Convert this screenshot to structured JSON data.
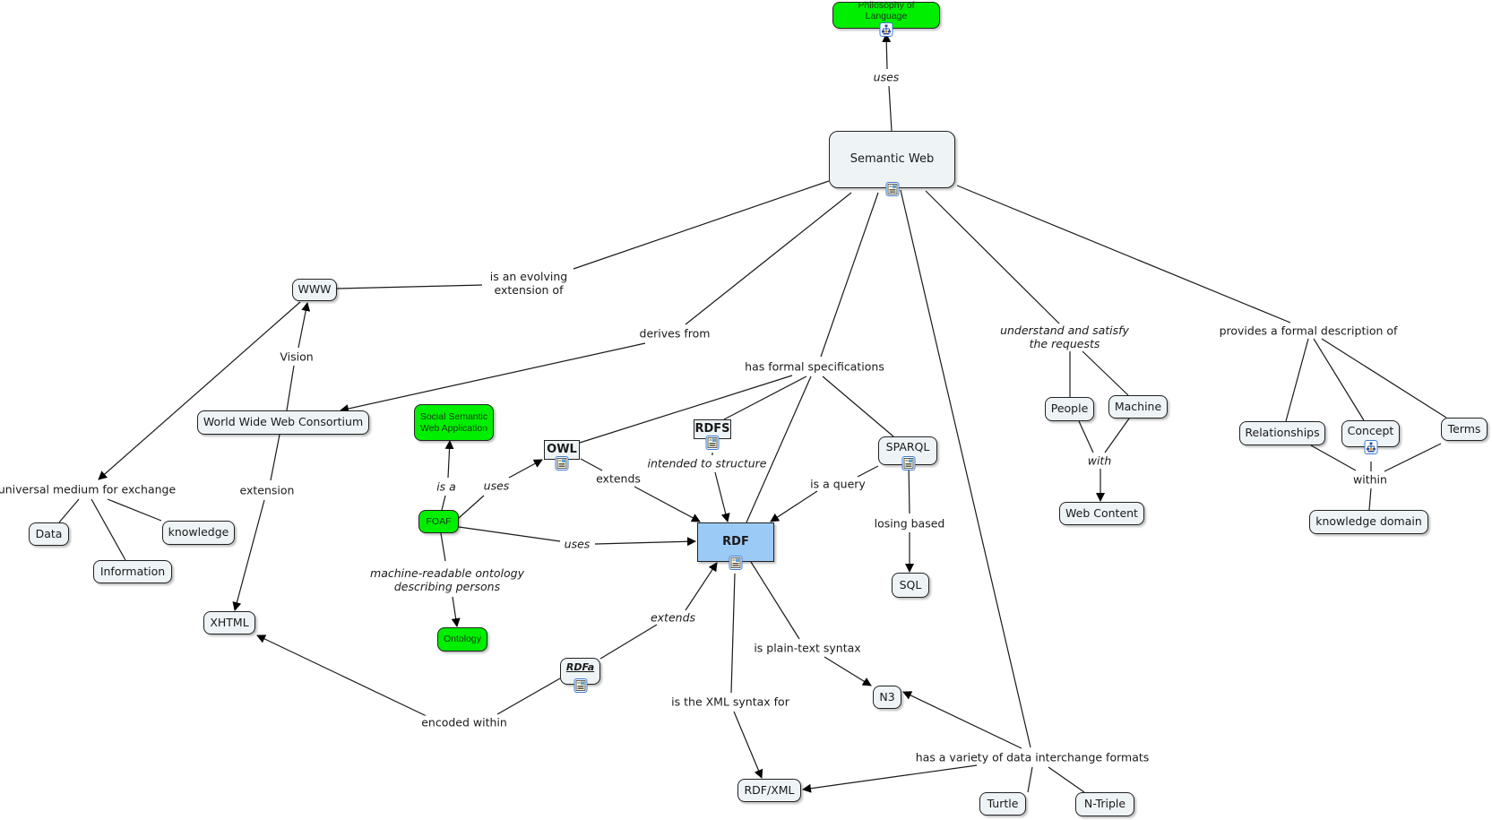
{
  "map_title": "Semantic Web",
  "colors": {
    "default_node": "#eef3f6",
    "highlight_node": "#9ccaf6",
    "green_node": "#00ee00",
    "resource_icon_border": "#3b7bd0",
    "line": "#1a1a1a"
  },
  "concepts": {
    "philosophy": "Philosophy of Language",
    "semantic_web": "Semantic Web",
    "www": "WWW",
    "w3c": "World Wide Web Consortium",
    "social_app": "Social Semantic Web Application",
    "owl": "OWL",
    "rdfs": "RDFS",
    "sparql": "SPARQL",
    "foaf": "FOAF",
    "rdf": "RDF",
    "sql": "SQL",
    "ontology": "Ontology",
    "xhtml": "XHTML",
    "rdfa": "RDFa",
    "n3": "N3",
    "rdfxml": "RDF/XML",
    "turtle": "Turtle",
    "ntriple": "N-Triple",
    "data": "Data",
    "information": "Information",
    "knowledge": "knowledge",
    "people": "People",
    "machine": "Machine",
    "web_content": "Web Content",
    "relationships": "Relationships",
    "concept": "Concept",
    "terms": "Terms",
    "knowledge_domain": "knowledge domain"
  },
  "linking_phrases": {
    "uses_philosophy": "uses",
    "evolving_extension": "is an evolving extension of",
    "derives_from": "derives from",
    "vision": "Vision",
    "formal_specs": "has formal specifications",
    "understand_satisfy": "understand and satisfy the requests",
    "formal_description": "provides a formal description of",
    "universal_medium": "universal medium for exchange",
    "extension": "extension",
    "is_a": "is a",
    "uses_owl": "uses",
    "extends_owl": "extends",
    "intended_structure": "intended to structure",
    "is_a_query": "is a query",
    "losing_based": "losing based",
    "uses_rdf": "uses",
    "machine_readable": "machine-readable ontology describing persons",
    "extends_rdfa": "extends",
    "plain_text": "is plain-text syntax",
    "xml_syntax": "is the XML syntax for",
    "encoded_within": "encoded within",
    "interchange_formats": "has a variety of data interchange formats",
    "with": "with",
    "within": "within"
  },
  "icons": {
    "concept_map_link": "concept-map-icon",
    "resource_doc": "document-image-icon"
  }
}
